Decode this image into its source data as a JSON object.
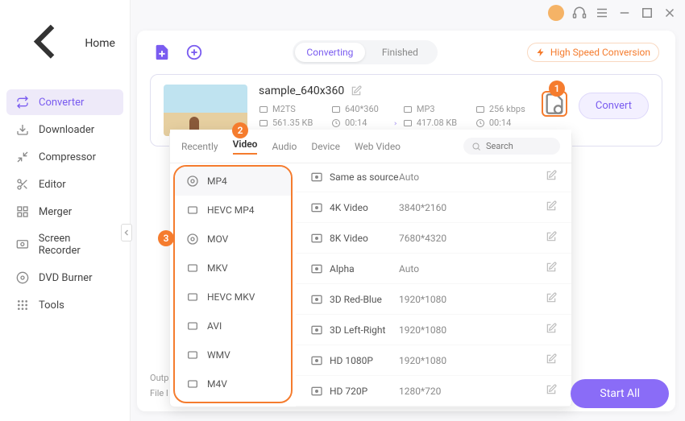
{
  "sidebar": {
    "home": "Home",
    "items": [
      {
        "label": "Converter"
      },
      {
        "label": "Downloader"
      },
      {
        "label": "Compressor"
      },
      {
        "label": "Editor"
      },
      {
        "label": "Merger"
      },
      {
        "label": "Screen Recorder"
      },
      {
        "label": "DVD Burner"
      },
      {
        "label": "Tools"
      }
    ]
  },
  "topbar": {
    "converting": "Converting",
    "finished": "Finished",
    "hsc": "High Speed Conversion"
  },
  "task": {
    "title": "sample_640x360",
    "src": {
      "format": "M2TS",
      "res": "640*360",
      "size": "561.35 KB",
      "dur": "00:14"
    },
    "dst": {
      "format": "MP3",
      "bitrate": "256 kbps",
      "size": "417.08 KB",
      "dur": "00:14"
    },
    "convert": "Convert"
  },
  "popup": {
    "tabs": [
      "Recently",
      "Video",
      "Audio",
      "Device",
      "Web Video"
    ],
    "search_placeholder": "Search",
    "formats": [
      "MP4",
      "HEVC MP4",
      "MOV",
      "MKV",
      "HEVC MKV",
      "AVI",
      "WMV",
      "M4V"
    ],
    "resolutions": [
      {
        "name": "Same as source",
        "size": "Auto"
      },
      {
        "name": "4K Video",
        "size": "3840*2160"
      },
      {
        "name": "8K Video",
        "size": "7680*4320"
      },
      {
        "name": "Alpha",
        "size": "Auto"
      },
      {
        "name": "3D Red-Blue",
        "size": "1920*1080"
      },
      {
        "name": "3D Left-Right",
        "size": "1920*1080"
      },
      {
        "name": "HD 1080P",
        "size": "1920*1080"
      },
      {
        "name": "HD 720P",
        "size": "1280*720"
      }
    ]
  },
  "bottom": {
    "output": "Outp",
    "file": "File l"
  },
  "start_all": "Start All",
  "callouts": {
    "c1": "1",
    "c2": "2",
    "c3": "3"
  }
}
